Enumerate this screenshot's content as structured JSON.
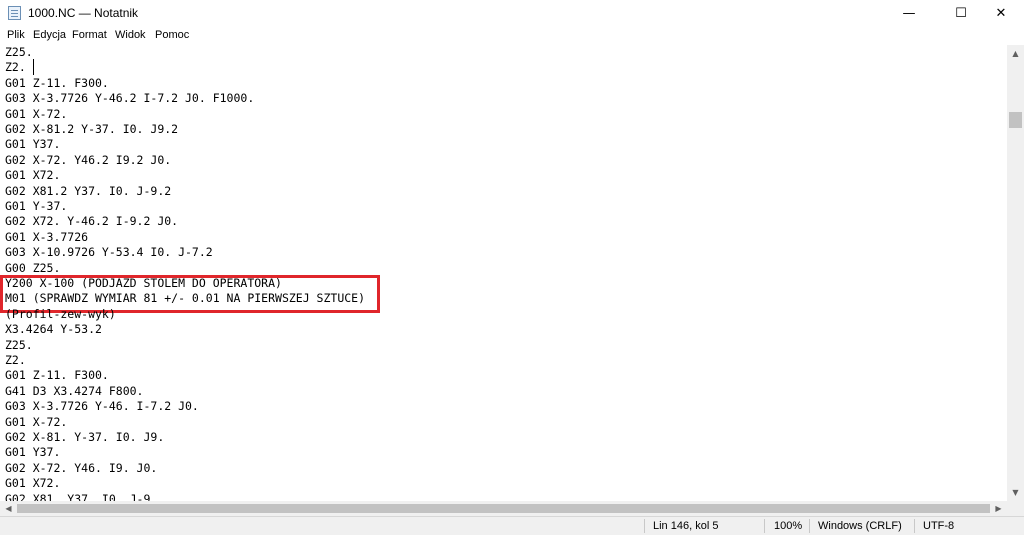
{
  "window": {
    "title": "1000.NC — Notatnik",
    "app_icon": "notepad-icon",
    "buttons": {
      "minimize": "—",
      "maximize": "☐",
      "close": "✕"
    }
  },
  "menu": [
    "Plik",
    "Edycja",
    "Format",
    "Widok",
    "Pomoc"
  ],
  "editor": {
    "lines": [
      "Z25.",
      "Z2.",
      "G01 Z-11. F300.",
      "G03 X-3.7726 Y-46.2 I-7.2 J0. F1000.",
      "G01 X-72.",
      "G02 X-81.2 Y-37. I0. J9.2",
      "G01 Y37.",
      "G02 X-72. Y46.2 I9.2 J0.",
      "G01 X72.",
      "G02 X81.2 Y37. I0. J-9.2",
      "G01 Y-37.",
      "G02 X72. Y-46.2 I-9.2 J0.",
      "G01 X-3.7726",
      "G03 X-10.9726 Y-53.4 I0. J-7.2",
      "G00 Z25.",
      "Y200 X-100 (PODJAZD STOLEM DO OPERATORA)",
      "M01 (SPRAWDZ WYMIAR 81 +/- 0.01 NA PIERWSZEJ SZTUCE)",
      "(Profil-zew-wyk)",
      "X3.4264 Y-53.2",
      "Z25.",
      "Z2.",
      "G01 Z-11. F300.",
      "G41 D3 X3.4274 F800.",
      "G03 X-3.7726 Y-46. I-7.2 J0.",
      "G01 X-72.",
      "G02 X-81. Y-37. I0. J9.",
      "G01 Y37.",
      "G02 X-72. Y46. I9. J0.",
      "G01 X72.",
      "G02 X81. Y37. I0. J-9."
    ],
    "highlighted_lines": [
      15,
      16
    ],
    "highlight_color": "#e0262b"
  },
  "status": {
    "position": "Lin 146, kol 5",
    "zoom": "100%",
    "line_endings": "Windows (CRLF)",
    "encoding": "UTF-8"
  }
}
